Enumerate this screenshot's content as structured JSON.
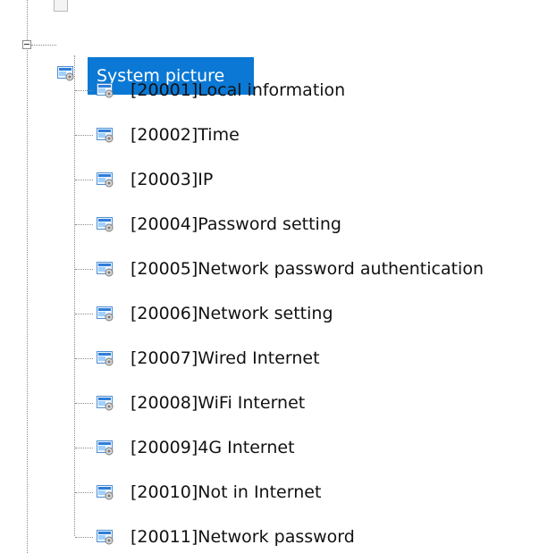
{
  "tree": {
    "root": {
      "label": "System picture",
      "expanded": true,
      "selected": true,
      "icon": "picture-folder-icon"
    },
    "children": [
      {
        "label": "[20001]Local information",
        "icon": "picture-icon"
      },
      {
        "label": "[20002]Time",
        "icon": "picture-icon"
      },
      {
        "label": "[20003]IP",
        "icon": "picture-icon"
      },
      {
        "label": "[20004]Password setting",
        "icon": "picture-icon"
      },
      {
        "label": "[20005]Network password authentication",
        "icon": "picture-icon"
      },
      {
        "label": "[20006]Network setting",
        "icon": "picture-icon"
      },
      {
        "label": "[20007]Wired Internet",
        "icon": "picture-icon"
      },
      {
        "label": "[20008]WiFi Internet",
        "icon": "picture-icon"
      },
      {
        "label": "[20009]4G Internet",
        "icon": "picture-icon"
      },
      {
        "label": "[20010]Not in Internet",
        "icon": "picture-icon"
      },
      {
        "label": "[20011]Network password",
        "icon": "picture-icon"
      }
    ]
  },
  "colors": {
    "selection": "#0a78d4",
    "selection_text": "#ffffff",
    "text": "#111111",
    "connector": "#8a8a8a"
  }
}
